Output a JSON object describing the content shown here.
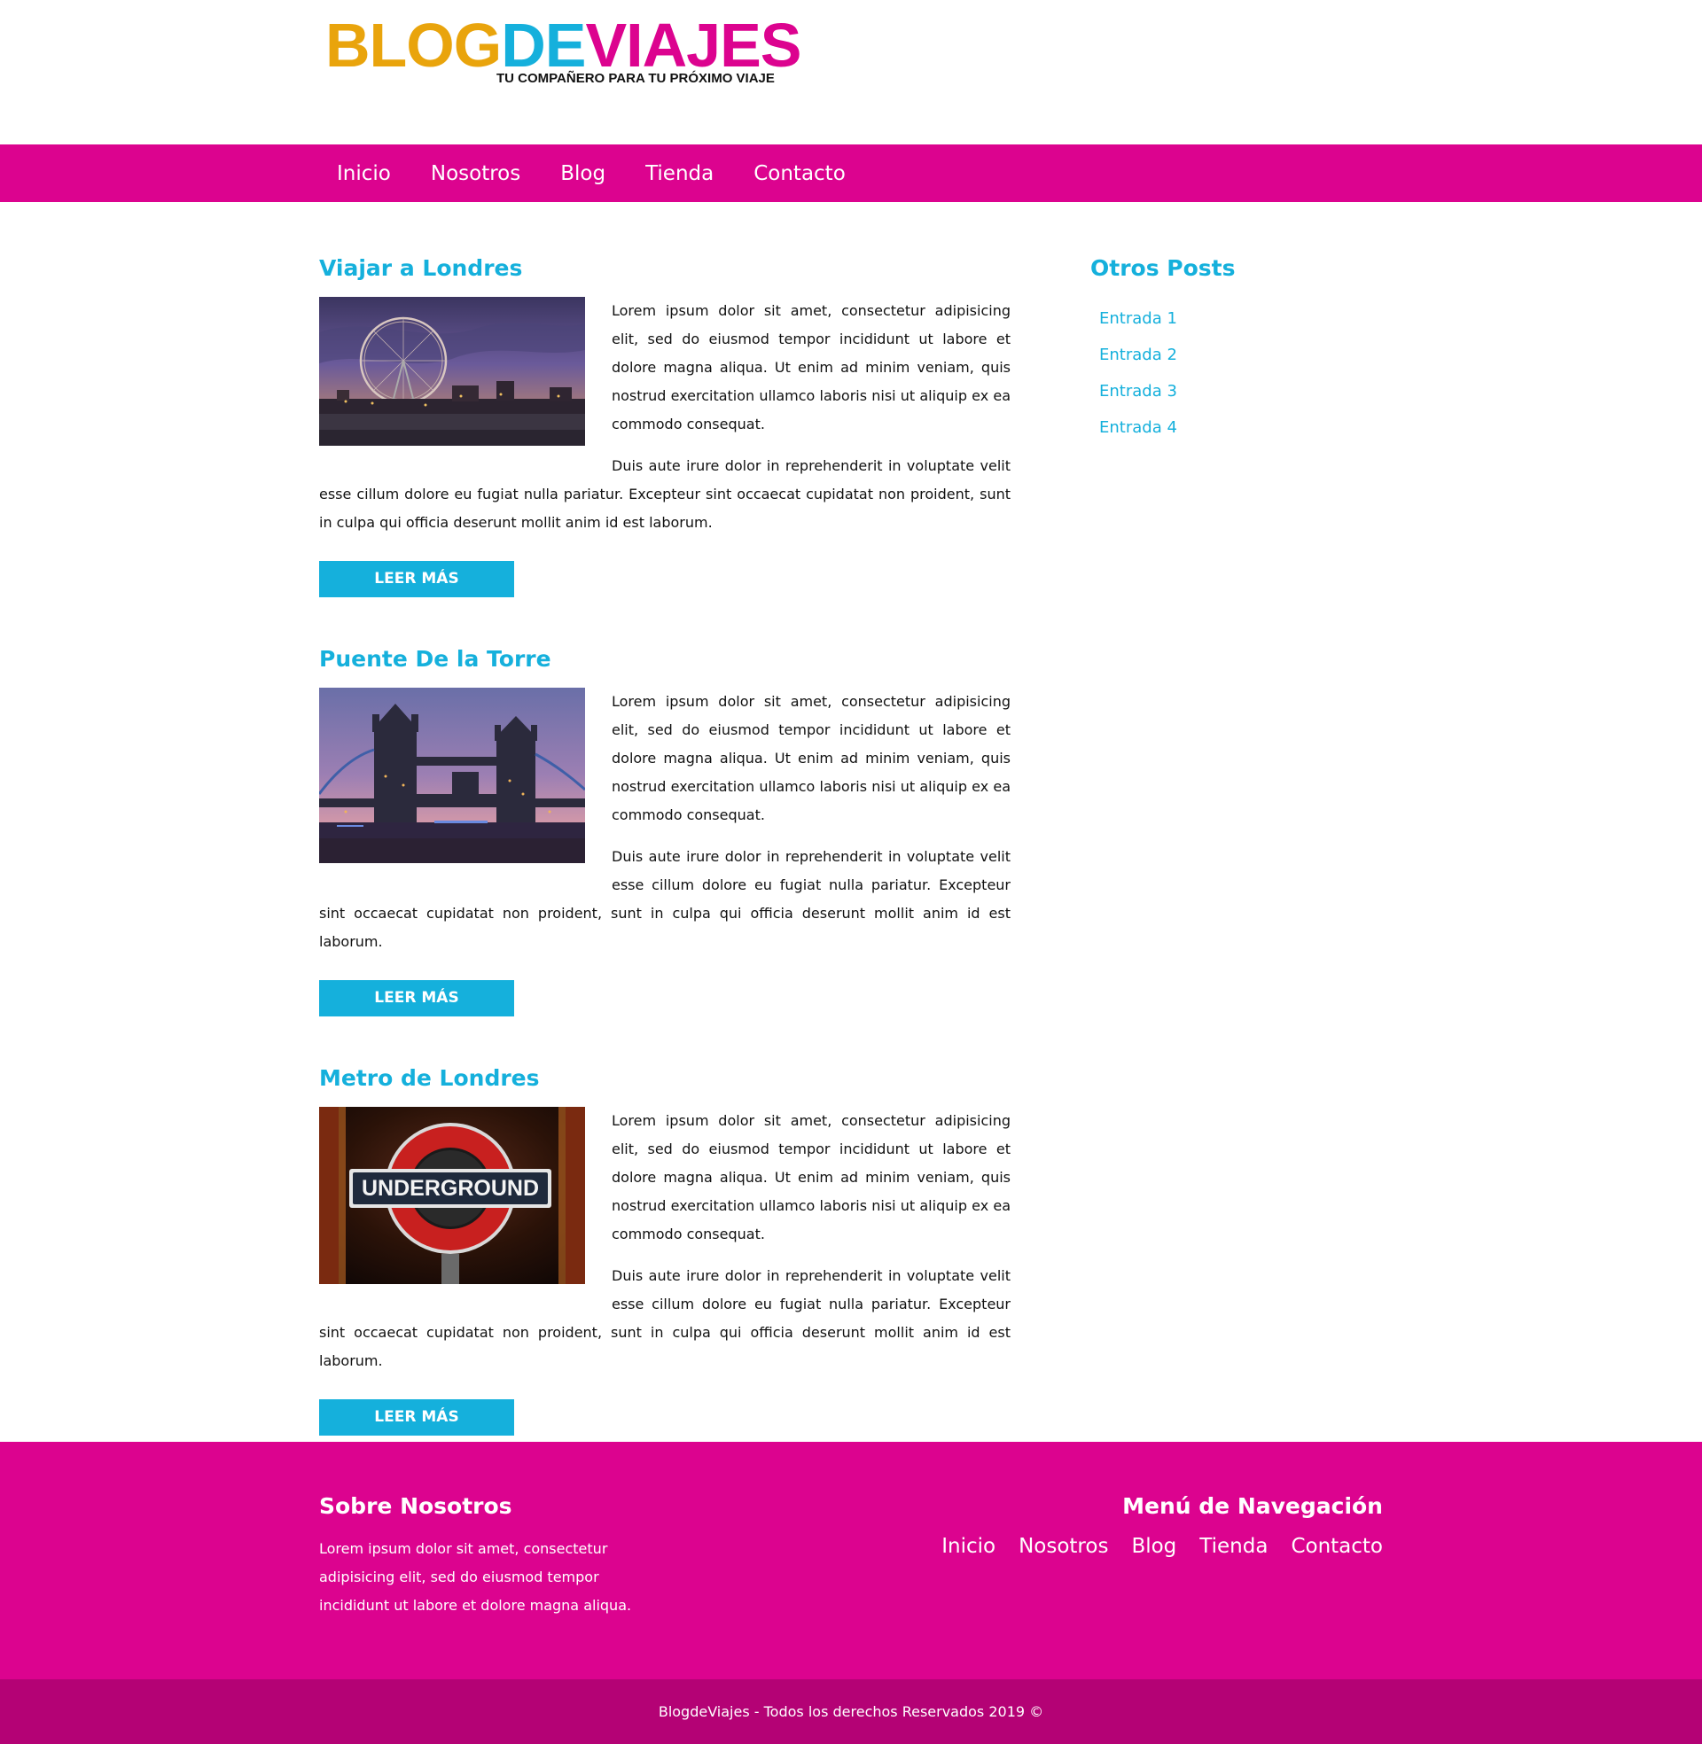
{
  "header": {
    "logo_part1": "BLOG",
    "logo_part2": "DE",
    "logo_part3": "VIAJES",
    "tagline": "TU COMPAÑERO PARA TU PRÓXIMO VIAJE"
  },
  "nav": {
    "items": [
      "Inicio",
      "Nosotros",
      "Blog",
      "Tienda",
      "Contacto"
    ]
  },
  "posts": [
    {
      "title": "Viajar a Londres",
      "image_icon": "ferris-wheel-photo",
      "p1": "Lorem ipsum dolor sit amet, consectetur adipisicing elit, sed do eiusmod tempor incididunt ut labore et dolore magna aliqua. Ut enim ad minim veniam, quis nostrud exercitation ullamco laboris nisi ut aliquip ex ea commodo consequat.",
      "p2": "Duis aute irure dolor in reprehenderit in voluptate velit esse cillum dolore eu fugiat nulla pariatur. Excepteur sint occaecat cupidatat non proident, sunt in culpa qui officia deserunt mollit anim id est laborum.",
      "button": "LEER MÁS"
    },
    {
      "title": "Puente De la Torre",
      "image_icon": "tower-bridge-photo",
      "p1": "Lorem ipsum dolor sit amet, consectetur adipisicing elit, sed do eiusmod tempor incididunt ut labore et dolore magna aliqua. Ut enim ad minim veniam, quis nostrud exercitation ullamco laboris nisi ut aliquip ex ea commodo consequat.",
      "p2": "Duis aute irure dolor in reprehenderit in voluptate velit esse cillum dolore eu fugiat nulla pariatur. Excepteur sint occaecat cupidatat non proident, sunt in culpa qui officia deserunt mollit anim id est laborum.",
      "button": "LEER MÁS"
    },
    {
      "title": "Metro de Londres",
      "image_icon": "underground-sign-photo",
      "image_text": "UNDERGROUND",
      "p1": "Lorem ipsum dolor sit amet, consectetur adipisicing elit, sed do eiusmod tempor incididunt ut labore et dolore magna aliqua. Ut enim ad minim veniam, quis nostrud exercitation ullamco laboris nisi ut aliquip ex ea commodo consequat.",
      "p2": "Duis aute irure dolor in reprehenderit in voluptate velit esse cillum dolore eu fugiat nulla pariatur. Excepteur sint occaecat cupidatat non proident, sunt in culpa qui officia deserunt mollit anim id est laborum.",
      "button": "LEER MÁS"
    }
  ],
  "sidebar": {
    "title": "Otros Posts",
    "items": [
      "Entrada 1",
      "Entrada 2",
      "Entrada 3",
      "Entrada 4"
    ]
  },
  "footer": {
    "about_title": "Sobre Nosotros",
    "about_text": "Lorem ipsum dolor sit amet, consectetur adipisicing elit, sed do eiusmod tempor incididunt ut labore et dolore magna aliqua.",
    "nav_title": "Menú de Navegación",
    "nav_items": [
      "Inicio",
      "Nosotros",
      "Blog",
      "Tienda",
      "Contacto"
    ],
    "copyright": "BlogdeViajes - Todos los derechos Reservados 2019 ©"
  },
  "colors": {
    "magenta": "#dc038f",
    "cyan": "#15b0dc",
    "orange": "#e9a40c",
    "footer_dark": "#b40275"
  }
}
